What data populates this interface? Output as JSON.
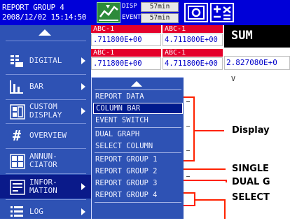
{
  "topbar": {
    "title": "REPORT GROUP 4",
    "datetime": "2008/12/02 15:14:50",
    "disp_label": "DISP",
    "event_label": "EVENT",
    "disp_time": "57min",
    "event_time": "57min"
  },
  "grid": {
    "cells": [
      {
        "head": "ABC-1",
        "value": ".711800E+00"
      },
      {
        "head": "ABC-1",
        "value": "4.711800E+00"
      },
      {
        "head": "ABC-1",
        "value": ".711800E+00"
      },
      {
        "head": "ABC-1",
        "value": "4.711800E+00"
      }
    ],
    "sum_label": "SUM",
    "sum_value": "2.827080E+0",
    "unit": "V"
  },
  "left_menu": {
    "items": [
      {
        "label": "DIGITAL",
        "icon": "digital-grid-icon",
        "arrow": true
      },
      {
        "label": "BAR",
        "icon": "bar-graph-icon",
        "arrow": true
      },
      {
        "label": "CUSTOM\nDISPLAY",
        "icon": "custom-display-icon",
        "arrow": true
      },
      {
        "label": "OVERVIEW",
        "icon": "hash-grid-icon",
        "arrow": false
      },
      {
        "label": "ANNUN-\nCIATOR",
        "icon": "annunciator-icon",
        "arrow": false
      },
      {
        "label": "INFOR-\nMATION",
        "icon": "information-icon",
        "arrow": true
      },
      {
        "label": "LOG",
        "icon": "log-list-icon",
        "arrow": true
      }
    ]
  },
  "submenu": {
    "items": [
      "REPORT DATA",
      "COLUMN BAR",
      "EVENT SWITCH",
      "DUAL GRAPH",
      "SELECT COLUMN",
      "REPORT GROUP 1",
      "REPORT GROUP 2",
      "REPORT GROUP 3",
      "REPORT GROUP 4"
    ],
    "selected": "COLUMN BAR"
  },
  "annotations": {
    "display": "Display",
    "single": "SINGLE",
    "dual": "DUAL G",
    "select": "SELECT"
  },
  "colors": {
    "topbar": "#0000d8",
    "menu": "#2e52b4",
    "cell_header": "#e4002b",
    "callout_line": "#ff2200"
  }
}
